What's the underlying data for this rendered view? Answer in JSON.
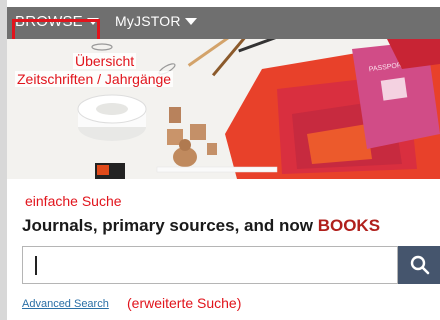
{
  "nav": {
    "browse_label": "BROWSE",
    "myjstor_label": "MyJSTOR"
  },
  "annotations": {
    "browse_line1": "Übersicht",
    "browse_line2": "Zeitschriften / Jahrgänge",
    "simple_search": "einfache Suche",
    "advanced_search": "(erweiterte Suche)"
  },
  "hero": {
    "passport_text": "PASSPORT"
  },
  "search": {
    "headline_prefix": "Journals, primary sources, and now ",
    "headline_accent": "BOOKS",
    "advanced_link": "Advanced Search"
  },
  "colors": {
    "navbar": "#6f6f6f",
    "annotation_red": "#e1141c",
    "search_button": "#45556d",
    "accent": "#b0201c"
  }
}
